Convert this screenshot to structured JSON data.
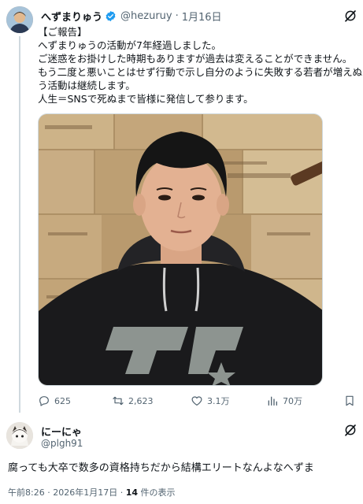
{
  "tweet": {
    "author_name": "へずまりゅう",
    "handle": "@hezuruy",
    "separator": "·",
    "date": "1月16日",
    "lines": [
      "【ご報告】",
      "へずまりゅうの活動が7年経過しました。",
      "ご迷惑をお掛けした時期もありますが過去は変えることができません。",
      "もう二度と悪いことはせず行動で示し自分のように失敗する若者が増えぬよ",
      "う活動は継続します。",
      "人生＝SNSで死ぬまで皆様に発信して参ります。"
    ],
    "media_icon": "photo-of-man-in-black-dc-hoodie",
    "actions": {
      "replies": "625",
      "retweets": "2,623",
      "likes": "3.1万",
      "views": "70万"
    }
  },
  "reply": {
    "author_name": "にーにゃ",
    "handle": "@plgh91",
    "text": "腐っても大卒で数多の資格持ちだから結構エリートなんよなへずま",
    "time": "午前8:26",
    "separator": "·",
    "date": "2026年1月17日",
    "views_count": "14",
    "views_label": "件の表示"
  },
  "colors": {
    "text": "#0f1419",
    "secondary": "#536471",
    "verified": "#1d9bf0",
    "border": "#cfd9de"
  }
}
